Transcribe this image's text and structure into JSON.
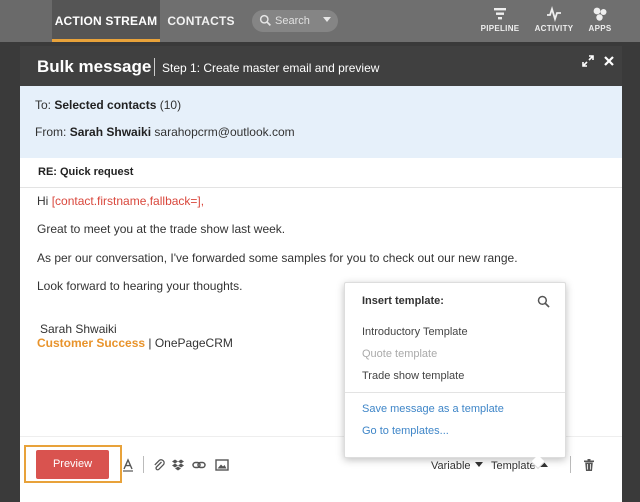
{
  "nav": {
    "tabs": [
      {
        "label": "ACTION STREAM",
        "active": true
      },
      {
        "label": "CONTACTS",
        "active": false
      }
    ],
    "search_placeholder": "Search",
    "right_items": [
      {
        "label": "PIPELINE",
        "icon": "filter-icon"
      },
      {
        "label": "ACTIVITY",
        "icon": "pulse-icon"
      },
      {
        "label": "APPS",
        "icon": "apps-icon"
      }
    ]
  },
  "modal": {
    "title": "Bulk message",
    "step": "Step 1: Create master email and preview",
    "to_label": "To:",
    "to_value": "Selected contacts",
    "to_count": "(10)",
    "from_label": "From:",
    "from_name": "Sarah Shwaiki",
    "from_email": "sarahopcrm@outlook.com",
    "subject": "RE: Quick request"
  },
  "email_body": {
    "greeting": "Hi",
    "merge_field": "[contact.firstname,fallback=]",
    "greeting_end": ",",
    "line1": "Great to meet you at the trade show last week.",
    "line2": "As per our conversation, I've forwarded some samples for you to check out our new range.",
    "line3": "Look forward to hearing your thoughts.",
    "sig_name": "Sarah Shwaiki",
    "sig_role": "Customer Success",
    "sig_sep": " | ",
    "sig_company": "OnePageCRM"
  },
  "template_popover": {
    "title": "Insert template:",
    "templates": [
      {
        "label": "Introductory Template",
        "disabled": false
      },
      {
        "label": "Quote template",
        "disabled": true
      },
      {
        "label": "Trade show template",
        "disabled": false
      }
    ],
    "save_link": "Save message as a template",
    "goto_link": "Go to templates..."
  },
  "toolbar": {
    "preview_label": "Preview",
    "variable_label": "Variable",
    "template_label": "Template"
  },
  "colors": {
    "accent": "#e8a23a",
    "preview_button": "#d9534f",
    "link": "#3f86c8",
    "merge_field": "#d9473c",
    "role": "#e8932b",
    "recipients_bg": "#e6f0fa"
  }
}
